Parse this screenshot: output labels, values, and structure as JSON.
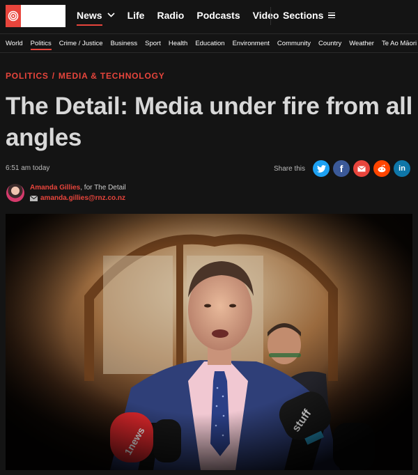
{
  "header": {
    "nav": [
      {
        "label": "News",
        "active": true
      },
      {
        "label": "Life"
      },
      {
        "label": "Radio"
      },
      {
        "label": "Podcasts"
      },
      {
        "label": "Video"
      }
    ],
    "sections_label": "Sections"
  },
  "subnav": [
    "World",
    "Politics",
    "Crime / Justice",
    "Business",
    "Sport",
    "Health",
    "Education",
    "Environment",
    "Community",
    "Country",
    "Weather",
    "Te Ao Māori"
  ],
  "subnav_active": "Politics",
  "article": {
    "kicker": [
      "POLITICS",
      "MEDIA & TECHNOLOGY"
    ],
    "headline": "The Detail: Media under fire from all angles",
    "time": "6:51 am today",
    "share_label": "Share this",
    "author_name": "Amanda Gillies",
    "author_suffix": ", for The Detail",
    "author_email": "amanda.gillies@rnz.co.nz"
  },
  "share_buttons": [
    {
      "name": "twitter",
      "glyph": "t",
      "color": "#1da1f2"
    },
    {
      "name": "facebook",
      "glyph": "f",
      "color": "#3b5998"
    },
    {
      "name": "email",
      "glyph": "✉",
      "color": "#e8453c"
    },
    {
      "name": "reddit",
      "glyph": "r",
      "color": "#ff4500"
    },
    {
      "name": "linkedin",
      "glyph": "in",
      "color": "#0e76a8"
    }
  ],
  "photo": {
    "mic_labels": [
      "1news",
      "stuff"
    ]
  },
  "colors": {
    "accent": "#e8453c",
    "background": "#141414"
  }
}
